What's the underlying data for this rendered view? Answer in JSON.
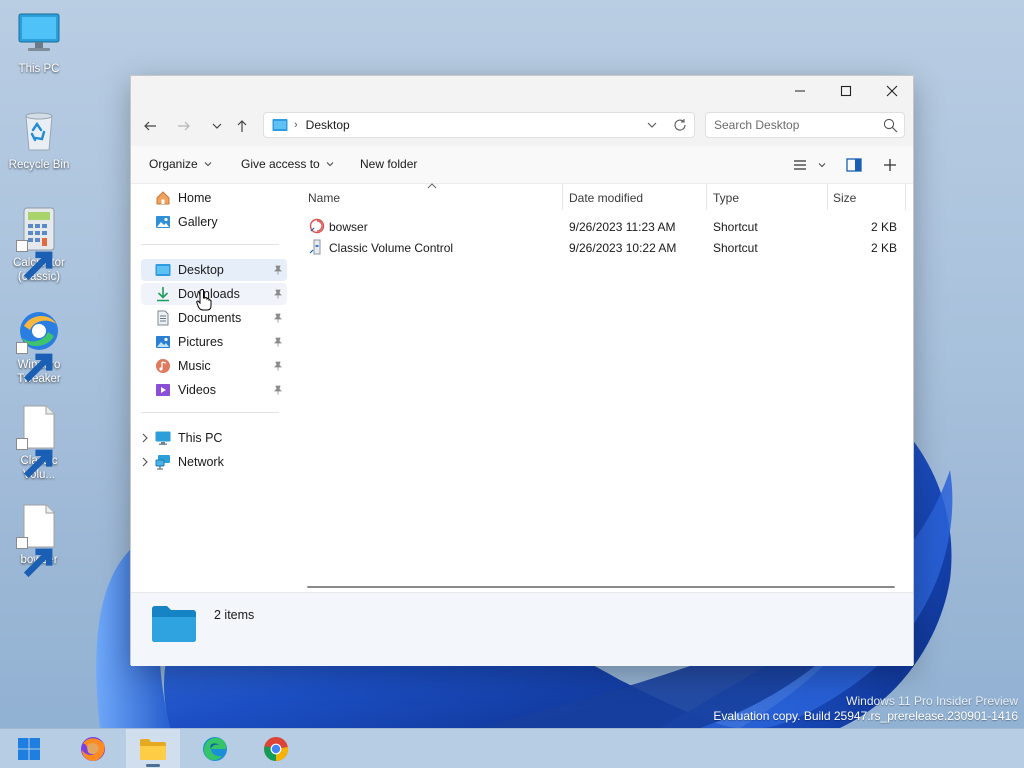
{
  "desktop": {
    "icons": [
      {
        "label": "This PC",
        "icon": "monitor-icon"
      },
      {
        "label": "Recycle Bin",
        "icon": "recycle-bin-icon"
      },
      {
        "label": "Calculator (classic)",
        "icon": "calculator-icon"
      },
      {
        "label": "Winaero Tweaker",
        "icon": "winaero-tweaker-icon"
      },
      {
        "label": "Classic Volu...",
        "icon": "blank-file-icon"
      },
      {
        "label": "bowser",
        "icon": "blank-file-icon"
      }
    ],
    "watermark": {
      "line1": "Windows 11 Pro Insider Preview",
      "line2": "Evaluation copy. Build 25947.rs_prerelease.230901-1416"
    }
  },
  "window": {
    "controls": {
      "minimize": "minimize-icon",
      "maximize": "maximize-icon",
      "close": "close-icon"
    },
    "address": {
      "path": "Desktop"
    },
    "search": {
      "placeholder": "Search Desktop"
    },
    "commands": {
      "organize": "Organize",
      "give_access": "Give access to",
      "new_folder": "New folder"
    },
    "sidebar": {
      "top": [
        {
          "label": "Home",
          "icon": "home-icon"
        },
        {
          "label": "Gallery",
          "icon": "gallery-icon"
        }
      ],
      "quick": [
        {
          "label": "Desktop",
          "icon": "desktop-folder-icon"
        },
        {
          "label": "Downloads",
          "icon": "download-icon"
        },
        {
          "label": "Documents",
          "icon": "document-icon"
        },
        {
          "label": "Pictures",
          "icon": "pictures-icon"
        },
        {
          "label": "Music",
          "icon": "music-icon"
        },
        {
          "label": "Videos",
          "icon": "videos-icon"
        }
      ],
      "bottom": [
        {
          "label": "This PC",
          "icon": "monitor-icon"
        },
        {
          "label": "Network",
          "icon": "network-icon"
        }
      ]
    },
    "columns": {
      "name": "Name",
      "date": "Date modified",
      "type": "Type",
      "size": "Size"
    },
    "files": [
      {
        "name": "bowser",
        "date": "9/26/2023 11:23 AM",
        "type": "Shortcut",
        "size": "2 KB",
        "icon": "bowser-icon"
      },
      {
        "name": "Classic Volume Control",
        "date": "9/26/2023 10:22 AM",
        "type": "Shortcut",
        "size": "2 KB",
        "icon": "volume-icon"
      }
    ],
    "status": {
      "count": "2 items"
    }
  },
  "taskbar": {
    "apps": [
      {
        "name": "start-button",
        "icon": "windows-logo-icon"
      },
      {
        "name": "firefox-button",
        "icon": "firefox-icon"
      },
      {
        "name": "file-explorer-button",
        "icon": "folder-icon"
      },
      {
        "name": "edge-button",
        "icon": "edge-icon"
      },
      {
        "name": "chrome-button",
        "icon": "chrome-icon"
      }
    ]
  }
}
